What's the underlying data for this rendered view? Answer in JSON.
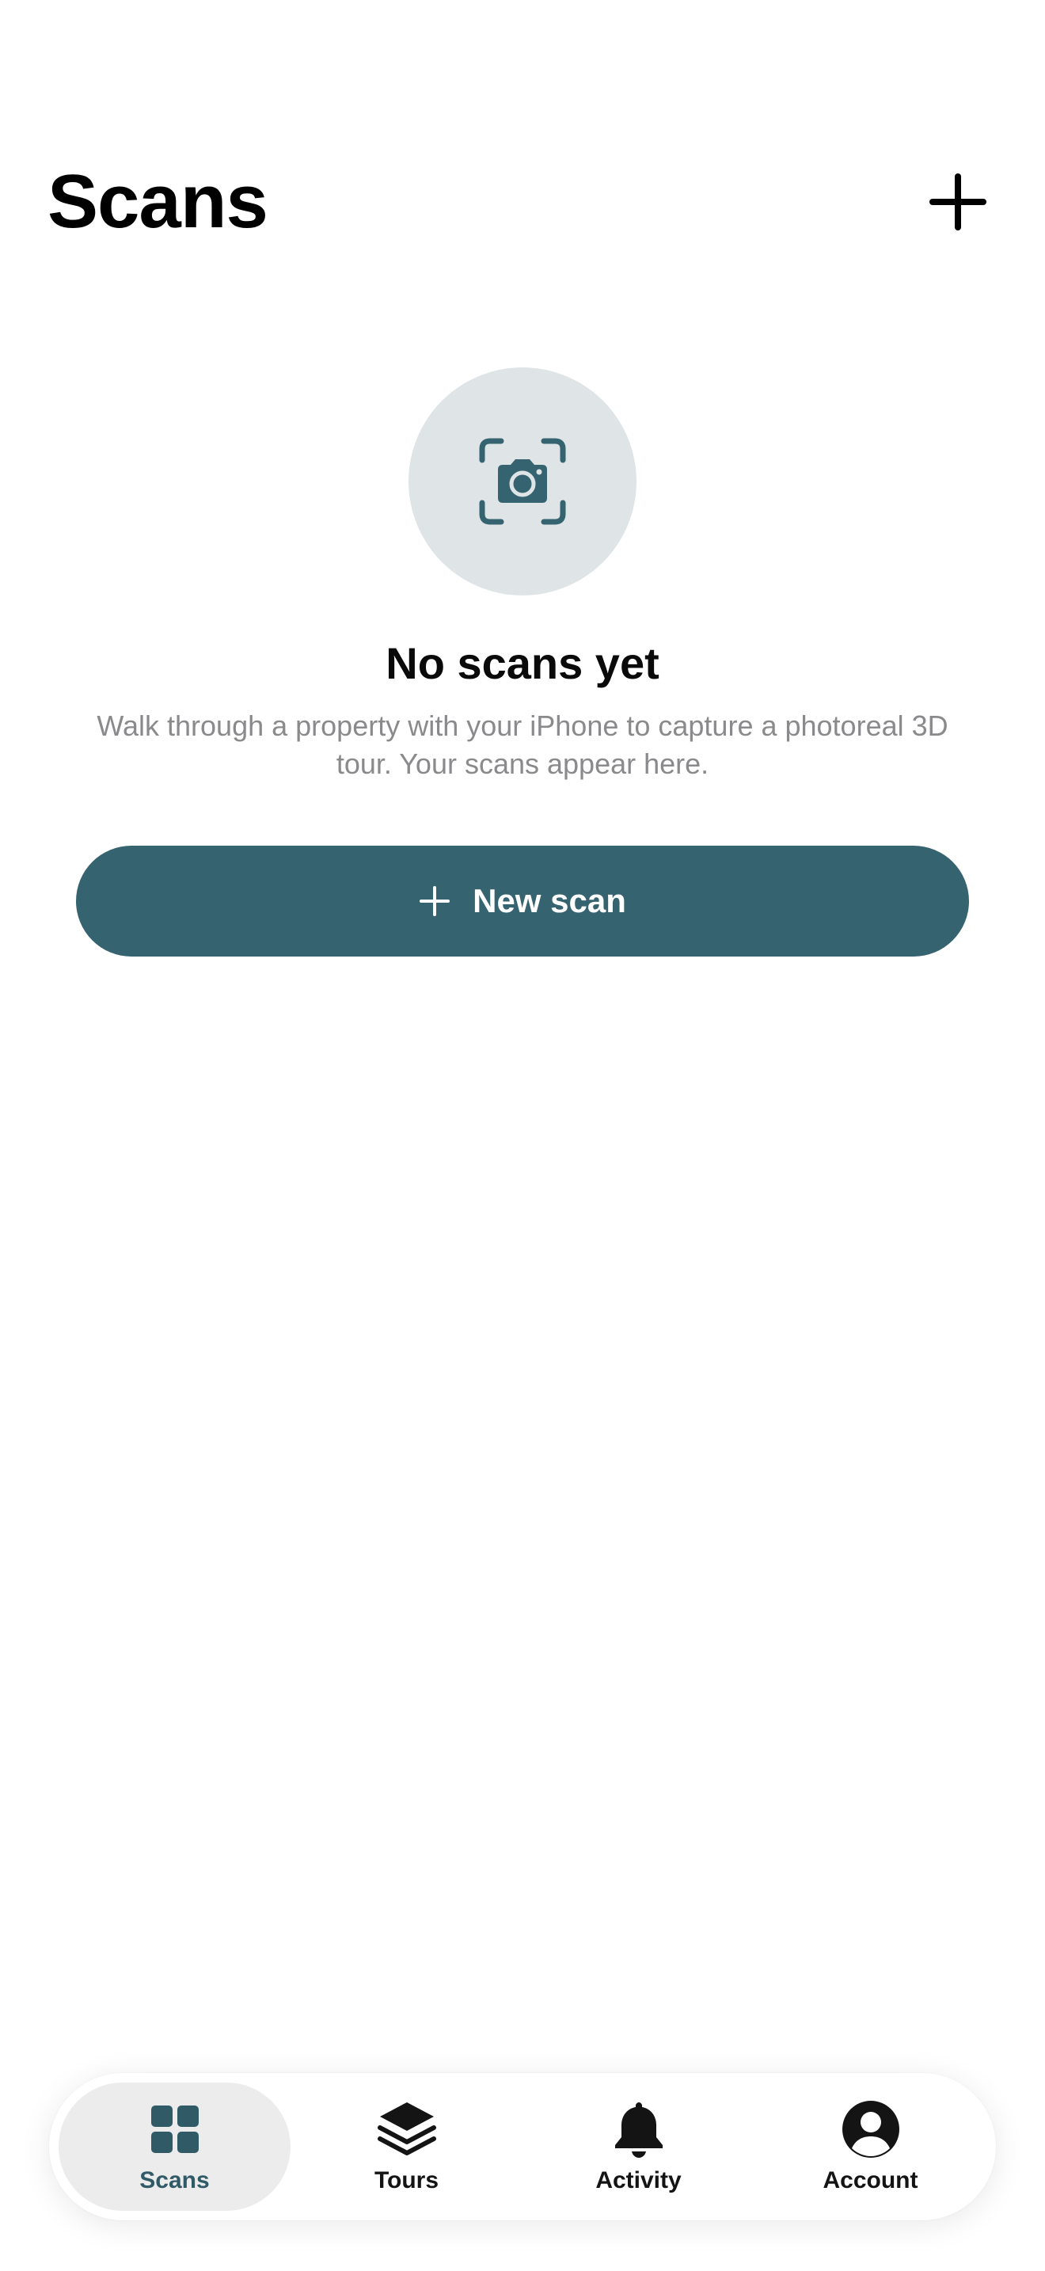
{
  "header": {
    "title": "Scans",
    "add_icon": "plus-icon"
  },
  "empty_state": {
    "icon": "camera-viewfinder-icon",
    "title": "No scans yet",
    "description": "Walk through a property with your iPhone to capture a photoreal 3D tour. Your scans appear here."
  },
  "new_scan_button": {
    "label": "New scan",
    "icon": "plus-icon"
  },
  "tab_bar": {
    "active": "Scans",
    "tabs": [
      {
        "label": "Scans",
        "icon": "grid-icon"
      },
      {
        "label": "Tours",
        "icon": "layers-icon"
      },
      {
        "label": "Activity",
        "icon": "bell-icon"
      },
      {
        "label": "Account",
        "icon": "person-circle-icon"
      }
    ]
  },
  "colors": {
    "accent": "#35636f",
    "icon_circle_bg": "#dfe5e7",
    "active_tab_bg": "#ececec",
    "secondary_text": "#8a8a8d"
  }
}
